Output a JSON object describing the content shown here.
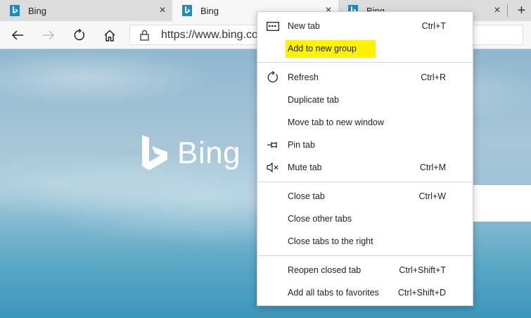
{
  "tabs": [
    {
      "title": "Bing",
      "close": "×"
    },
    {
      "title": "Bing",
      "close": "×"
    },
    {
      "title": "Bing",
      "close": "×"
    }
  ],
  "new_tab_glyph": "+",
  "address_bar": {
    "url": "https://www.bing.co"
  },
  "page": {
    "logo_text": "Bing"
  },
  "context_menu": {
    "items": [
      {
        "label": "New tab",
        "shortcut": "Ctrl+T",
        "icon": "new-tab-icon"
      },
      {
        "label": "Add to new group",
        "shortcut": "",
        "icon": "",
        "highlighted": true
      },
      {
        "label": "Refresh",
        "shortcut": "Ctrl+R",
        "icon": "refresh-icon"
      },
      {
        "label": "Duplicate tab",
        "shortcut": "",
        "icon": ""
      },
      {
        "label": "Move tab to new window",
        "shortcut": "",
        "icon": ""
      },
      {
        "label": "Pin tab",
        "shortcut": "",
        "icon": "pin-icon"
      },
      {
        "label": "Mute tab",
        "shortcut": "Ctrl+M",
        "icon": "mute-icon"
      },
      {
        "label": "Close tab",
        "shortcut": "Ctrl+W",
        "icon": ""
      },
      {
        "label": "Close other tabs",
        "shortcut": "",
        "icon": ""
      },
      {
        "label": "Close tabs to the right",
        "shortcut": "",
        "icon": ""
      },
      {
        "label": "Reopen closed tab",
        "shortcut": "Ctrl+Shift+T",
        "icon": ""
      },
      {
        "label": "Add all tabs to favorites",
        "shortcut": "Ctrl+Shift+D",
        "icon": ""
      }
    ]
  },
  "colors": {
    "highlight": "#fff200",
    "bing_accent": "#1e8bc3"
  }
}
